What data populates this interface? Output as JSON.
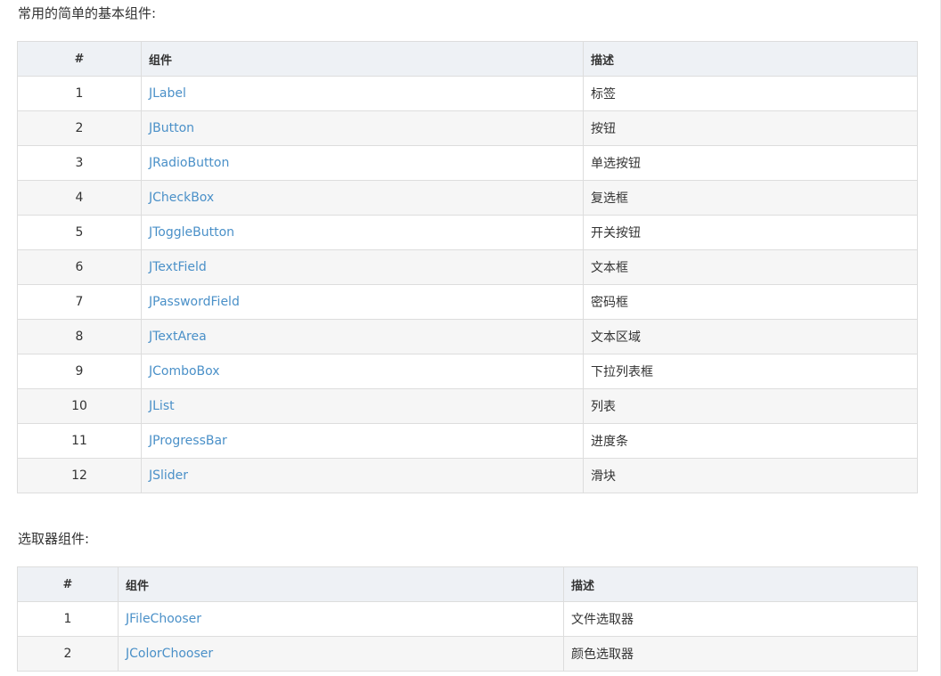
{
  "sections": [
    {
      "title": "常用的简单的基本组件:",
      "headers": {
        "num": "#",
        "component": "组件",
        "description": "描述"
      },
      "rows": [
        {
          "num": "1",
          "component": "JLabel",
          "description": "标签"
        },
        {
          "num": "2",
          "component": "JButton",
          "description": "按钮"
        },
        {
          "num": "3",
          "component": "JRadioButton",
          "description": "单选按钮"
        },
        {
          "num": "4",
          "component": "JCheckBox",
          "description": "复选框"
        },
        {
          "num": "5",
          "component": "JToggleButton",
          "description": "开关按钮"
        },
        {
          "num": "6",
          "component": "JTextField",
          "description": "文本框"
        },
        {
          "num": "7",
          "component": "JPasswordField",
          "description": "密码框"
        },
        {
          "num": "8",
          "component": "JTextArea",
          "description": "文本区域"
        },
        {
          "num": "9",
          "component": "JComboBox",
          "description": "下拉列表框"
        },
        {
          "num": "10",
          "component": "JList",
          "description": "列表"
        },
        {
          "num": "11",
          "component": "JProgressBar",
          "description": "进度条"
        },
        {
          "num": "12",
          "component": "JSlider",
          "description": "滑块"
        }
      ]
    },
    {
      "title": "选取器组件:",
      "headers": {
        "num": "#",
        "component": "组件",
        "description": "描述"
      },
      "rows": [
        {
          "num": "1",
          "component": "JFileChooser",
          "description": "文件选取器"
        },
        {
          "num": "2",
          "component": "JColorChooser",
          "description": "颜色选取器"
        }
      ]
    }
  ],
  "colors": {
    "link": "#4a90c8",
    "header_bg": "#eef1f5",
    "stripe_bg": "#f6f6f6",
    "border": "#dddddd"
  }
}
